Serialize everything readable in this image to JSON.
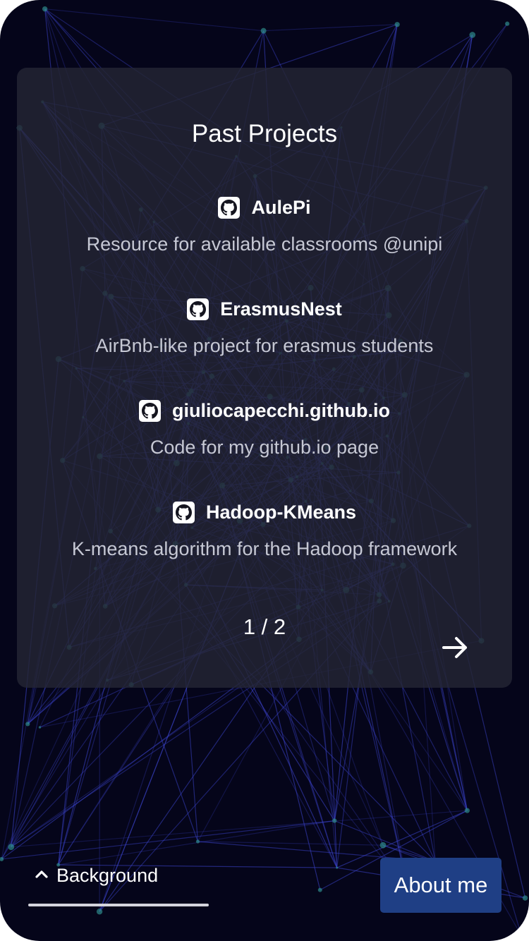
{
  "colors": {
    "background": "#05051a",
    "card": "#242634",
    "network_line": "#3a42c8",
    "network_node": "#2e8a8a",
    "accent_button": "#1f3f85",
    "text_primary": "#ffffff",
    "text_secondary": "#c6c8d4"
  },
  "card": {
    "title": "Past Projects",
    "projects": [
      {
        "icon": "github-icon",
        "name": "AulePi",
        "description": "Resource for available classrooms @unipi"
      },
      {
        "icon": "github-icon",
        "name": "ErasmusNest",
        "description": "AirBnb-like project for erasmus students"
      },
      {
        "icon": "github-icon",
        "name": "giuliocapecchi.github.io",
        "description": "Code for my github.io page"
      },
      {
        "icon": "github-icon",
        "name": "Hadoop-KMeans",
        "description": "K-means algorithm for the Hadoop framework"
      }
    ],
    "pagination": "1 / 2",
    "next_icon": "arrow-right-icon"
  },
  "footer": {
    "background_toggle": {
      "icon": "chevron-up-icon",
      "label": "Background"
    },
    "about_button": "About me"
  }
}
